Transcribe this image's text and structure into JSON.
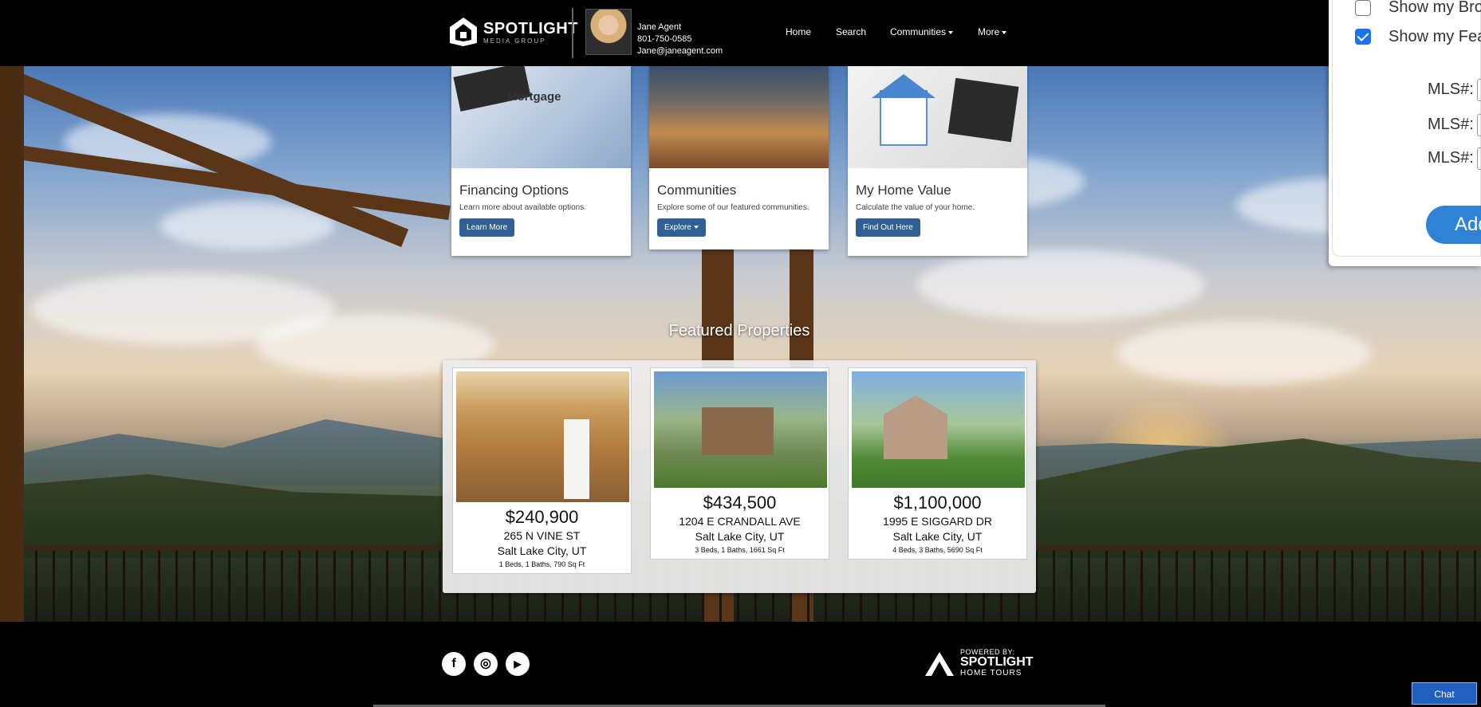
{
  "header": {
    "logo_name": "SPOTLIGHT",
    "logo_sub": "MEDIA GROUP",
    "agent_name": "Jane Agent",
    "agent_phone": "801-750-0585",
    "agent_email": "Jane@janeagent.com",
    "nav": [
      {
        "label": "Home"
      },
      {
        "label": "Search"
      },
      {
        "label": "Communities"
      },
      {
        "label": "More"
      }
    ]
  },
  "panel": {
    "checkbox1_label": "Show my Bro",
    "checkbox1_checked": false,
    "checkbox2_label": "Show my Fea",
    "checkbox2_checked": true,
    "mls_label": "MLS#:",
    "add_label": "Add"
  },
  "features": [
    {
      "title": "Financing Options",
      "desc": "Learn more about available options.",
      "button": "Learn More",
      "img_caption": "Mortgage"
    },
    {
      "title": "Communities",
      "desc": "Explore some of our featured communities.",
      "button": "Explore"
    },
    {
      "title": "My Home Value",
      "desc": "Calculate the value of your home.",
      "button": "Find Out Here"
    }
  ],
  "featured_title": "Featured Properties",
  "properties": [
    {
      "price": "$240,900",
      "address": "265 N VINE ST",
      "city": "Salt Lake City, UT",
      "specs": "1 Beds, 1 Baths, 790 Sq Ft"
    },
    {
      "price": "$434,500",
      "address": "1204 E CRANDALL AVE",
      "city": "Salt Lake City, UT",
      "specs": "3 Beds, 1 Baths, 1661 Sq Ft"
    },
    {
      "price": "$1,100,000",
      "address": "1995 E SIGGARD DR",
      "city": "Salt Lake City, UT",
      "specs": "4 Beds, 3 Baths, 5690 Sq Ft"
    }
  ],
  "footer": {
    "social": [
      {
        "icon": "facebook-icon",
        "glyph": "f"
      },
      {
        "icon": "instagram-icon",
        "glyph": "◎"
      },
      {
        "icon": "youtube-icon",
        "glyph": "▶"
      }
    ],
    "powered_by": "POWERED BY:",
    "brand": "SPOTLIGHT",
    "brand_sub": "HOME TOURS",
    "chat": "Chat"
  },
  "colors": {
    "button_blue": "#2f5f93",
    "panel_accent": "#2f82d6",
    "chat_blue": "#1f5fbf"
  }
}
